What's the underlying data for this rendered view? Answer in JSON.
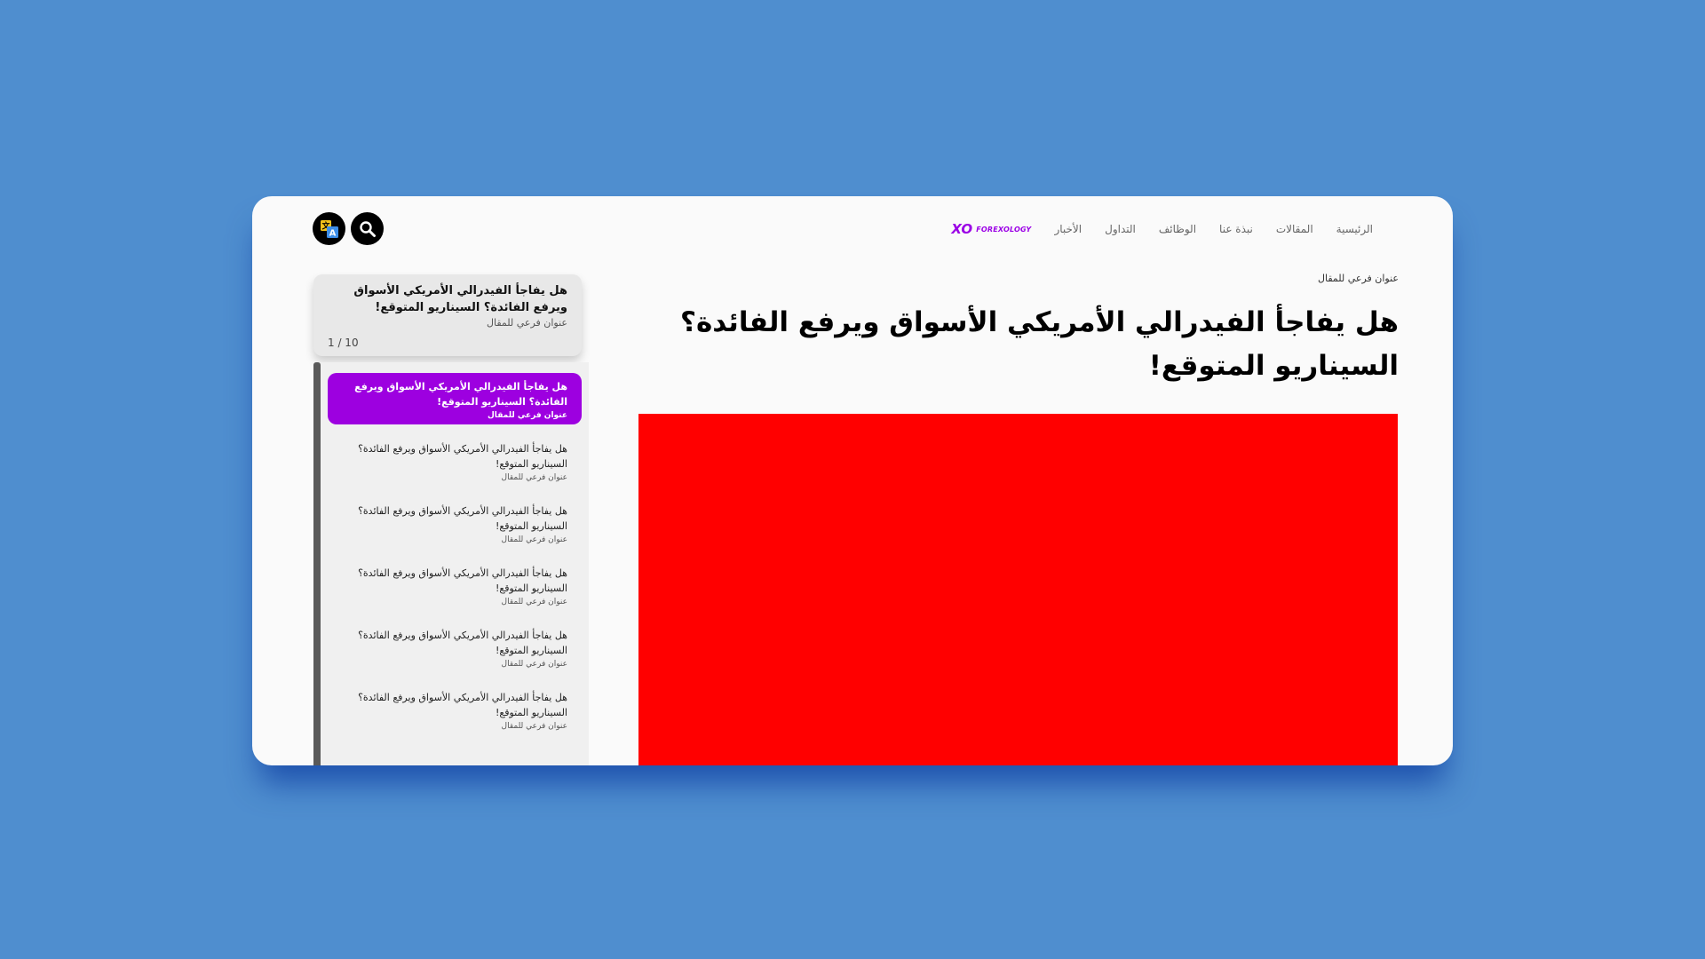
{
  "brand": {
    "logo_mark": "XO",
    "logo_text": "FOREXOLOGY",
    "accent_color": "#9b00e6"
  },
  "nav": {
    "items": [
      {
        "label": "الرئيسية"
      },
      {
        "label": "المقالات"
      },
      {
        "label": "نبذة عنا"
      },
      {
        "label": "الوظائف"
      },
      {
        "label": "التداول"
      },
      {
        "label": "الأخبار"
      }
    ]
  },
  "header_icons": {
    "search": "search-icon",
    "language": "translate-icon"
  },
  "article": {
    "eyebrow": "عنوان فرعي للمقال",
    "title": "هل يفاجأ الفيدرالي الأمريكي الأسواق ويرفع الفائدة؟ السيناريو المتوقع!",
    "hero_color": "#ff0000"
  },
  "sidebar": {
    "current": {
      "title": "هل يفاجأ الفيدرالي الأمريكي الأسواق ويرفع الفائدة؟ السيناريو المتوقع!",
      "subtitle": "عنوان فرعي للمقال",
      "counter": "1 / 10"
    },
    "items": [
      {
        "title": "هل يفاجأ الفيدرالي الأمريكي الأسواق ويرفع الفائدة؟ السيناريو المتوقع!",
        "subtitle": "عنوان فرعي للمقال",
        "active": true
      },
      {
        "title": "هل يفاجأ الفيدرالي الأمريكي الأسواق ويرفع الفائدة؟ السيناريو المتوقع!",
        "subtitle": "عنوان فرعي للمقال"
      },
      {
        "title": "هل يفاجأ الفيدرالي الأمريكي الأسواق ويرفع الفائدة؟ السيناريو المتوقع!",
        "subtitle": "عنوان فرعي للمقال"
      },
      {
        "title": "هل يفاجأ الفيدرالي الأمريكي الأسواق ويرفع الفائدة؟ السيناريو المتوقع!",
        "subtitle": "عنوان فرعي للمقال"
      },
      {
        "title": "هل يفاجأ الفيدرالي الأمريكي الأسواق ويرفع الفائدة؟ السيناريو المتوقع!",
        "subtitle": "عنوان فرعي للمقال"
      },
      {
        "title": "هل يفاجأ الفيدرالي الأمريكي الأسواق ويرفع الفائدة؟ السيناريو المتوقع!",
        "subtitle": "عنوان فرعي للمقال"
      }
    ]
  }
}
